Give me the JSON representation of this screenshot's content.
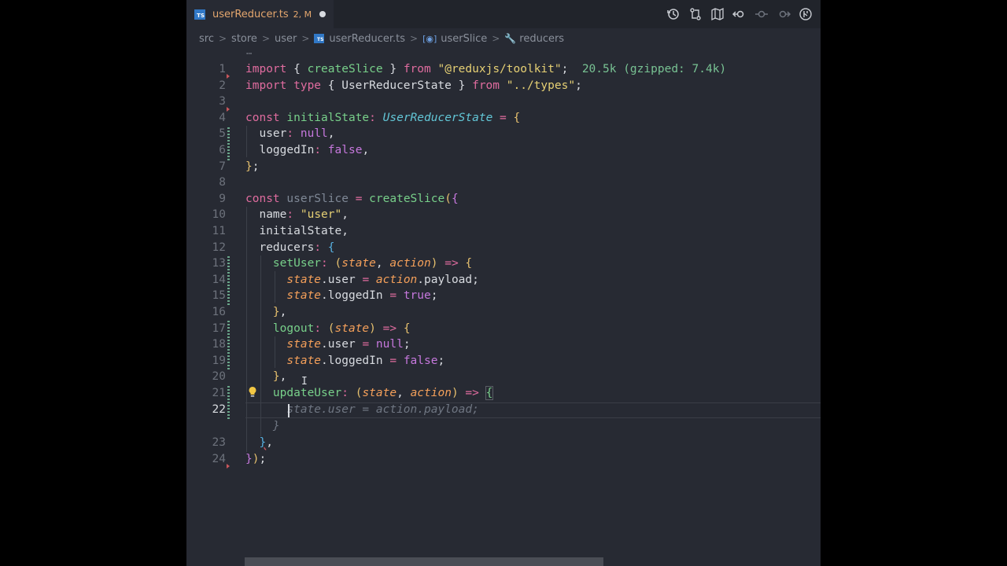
{
  "tab": {
    "filename": "userReducer.ts",
    "status": "2, M",
    "badge": "TS"
  },
  "breadcrumb": {
    "items": [
      "src",
      "store",
      "user",
      "userReducer.ts",
      "userSlice",
      "reducers"
    ],
    "separator": ">"
  },
  "editor": {
    "active_line": 22,
    "line_numbers": [
      "1",
      "2",
      "3",
      "4",
      "5",
      "6",
      "7",
      "8",
      "9",
      "10",
      "11",
      "12",
      "13",
      "14",
      "15",
      "16",
      "17",
      "18",
      "19",
      "20",
      "21",
      "22",
      "23",
      "24"
    ],
    "import_size_hint": "20.5k (gzipped: 7.4k)",
    "ghost_suggestion": "state.user = action.payload;",
    "ghost_close": "}"
  },
  "icons": [
    "history-icon",
    "compare-changes-icon",
    "map-icon",
    "go-back-icon",
    "go-forward-icon",
    "go-next-icon",
    "git-graph-icon"
  ],
  "colors": {
    "editor_bg": "#272a33",
    "tab_modified": "#e5a76e",
    "keyword": "#e06c9f",
    "string": "#e6d074",
    "function": "#78d08a",
    "type": "#62c6d6",
    "param": "#f5a05a"
  }
}
